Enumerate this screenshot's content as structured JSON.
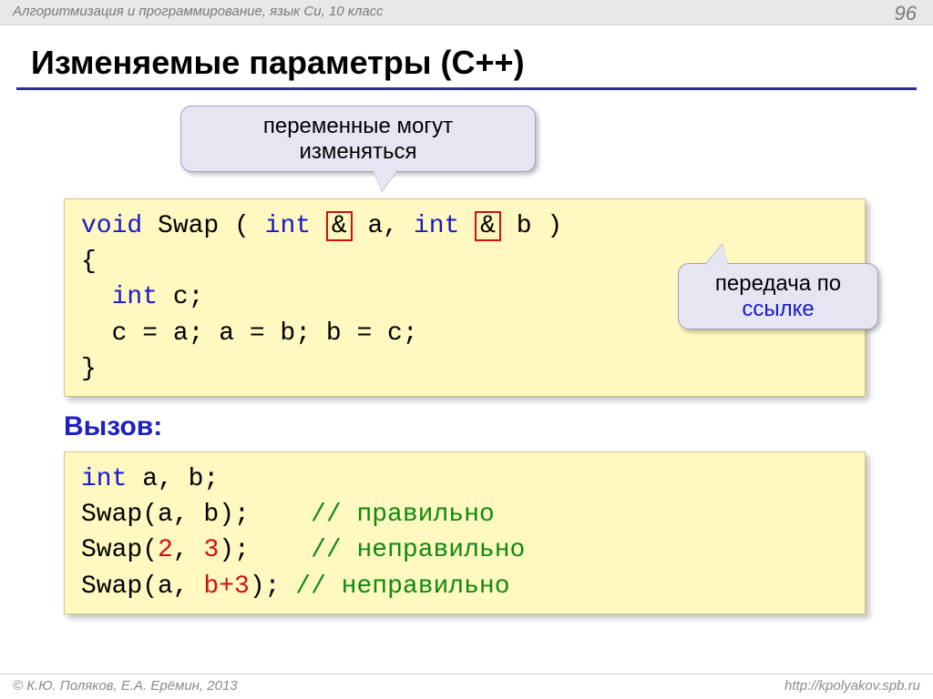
{
  "header": {
    "breadcrumb": "Алгоритмизация и программирование, язык Си, 10 класс",
    "page_number": "96"
  },
  "title": "Изменяемые параметры (C++)",
  "bubble_top": {
    "line1": "переменные могут",
    "line2": "изменяться"
  },
  "bubble_right": {
    "line1": "передача по",
    "line2": "ссылке"
  },
  "code1": {
    "void": "void",
    "swap": " Swap ( ",
    "int1": "int",
    "amp1": "&",
    "a": " a, ",
    "int2": "int",
    "amp2": "&",
    "b": " b )",
    "brace_open": "{",
    "int_c": "int",
    "c_decl": " c;",
    "swap_body": "  c = a; a = b; b = c;",
    "brace_close": "}"
  },
  "call_label": "Вызов:",
  "code2": {
    "int": "int",
    "decl": " a, b;",
    "l2a": "Swap(a, b);    ",
    "l2b": "// правильно",
    "l3a": "Swap(",
    "l3n1": "2",
    "l3m": ", ",
    "l3n2": "3",
    "l3b": ");    ",
    "l3c": "// неправильно",
    "l4a": "Swap(a, ",
    "l4r": "b+3",
    "l4b": "); ",
    "l4c": "// неправильно"
  },
  "footer": {
    "left": "© К.Ю. Поляков, Е.А. Ерёмин, 2013",
    "right": "http://kpolyakov.spb.ru"
  }
}
